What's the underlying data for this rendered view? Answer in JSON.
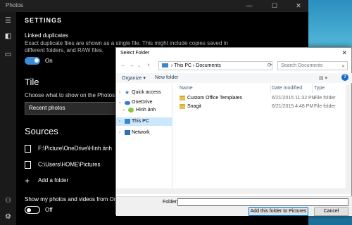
{
  "app": {
    "title": "Photos",
    "controls": [
      "—",
      "☐",
      "✕"
    ]
  },
  "rail": {
    "icons": [
      "hamburger-icon",
      "back-icon",
      "slideshow-icon",
      "person-icon",
      "gear-icon"
    ]
  },
  "settings": {
    "heading": "SETTINGS",
    "linked_duplicates": {
      "label": "Linked duplicates",
      "description": "Exact duplicate files are shown as a single file. This might include copies saved in different folders, and RAW files.",
      "toggle": "On"
    },
    "tile": {
      "heading": "Tile",
      "description": "Choose what to show on the Photos ti",
      "selected": "Recent photos"
    },
    "sources": {
      "heading": "Sources",
      "folders": [
        "F:\\Picture\\OneDrive\\Hình ảnh",
        "C:\\Users\\HOME\\Pictures"
      ],
      "add": "Add a folder"
    },
    "onedrive": {
      "label": "Show my photos and videos from One",
      "toggle": "Off"
    }
  },
  "dialog": {
    "title": "Select Folder",
    "address": [
      "This PC",
      "Documents"
    ],
    "search_placeholder": "Search Documents",
    "toolbar": {
      "organize": "Organize ▾",
      "new_folder": "New folder"
    },
    "tree": [
      {
        "label": "Quick access",
        "icon": "star-icon"
      },
      {
        "label": "OneDrive",
        "icon": "cloud-icon"
      },
      {
        "label": "Hình ảnh",
        "icon": "pictures-icon"
      },
      {
        "label": "This PC",
        "icon": "pc-icon",
        "selected": true
      },
      {
        "label": "Network",
        "icon": "network-icon"
      }
    ],
    "columns": [
      "Name",
      "Date modified",
      "Type"
    ],
    "files": [
      {
        "name": "Custom Office Templates",
        "date": "6/21/2015 11:32 PM",
        "type": "File folder"
      },
      {
        "name": "Snagit",
        "date": "6/21/2015 4:48 PM",
        "type": "File folder"
      }
    ],
    "folder_label": "Folder:",
    "folder_value": "",
    "buttons": {
      "add": "Add this folder to Pictures",
      "cancel": "Cancel"
    }
  }
}
